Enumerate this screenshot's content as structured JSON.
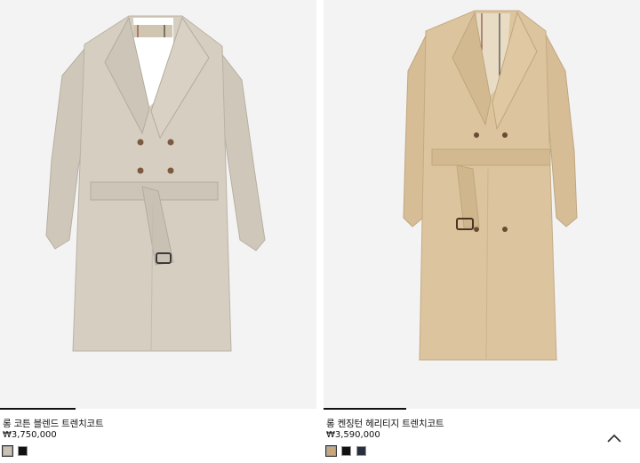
{
  "products": [
    {
      "name": "롱 코튼 블렌드 트렌치코트",
      "price": "₩3,750,000",
      "image_progress": 0.24,
      "colors": [
        "#c9c2b4",
        "#111111"
      ],
      "coat_color": "#d4cdbf"
    },
    {
      "name": "롱 켄징턴 헤리티지 트렌치코트",
      "price": "₩3,590,000",
      "image_progress": 0.26,
      "colors": [
        "#c9a77d",
        "#111111",
        "#2a2f40"
      ],
      "coat_color": "#dcc49e"
    }
  ],
  "scroll_top_icon": "chevron-up-icon"
}
